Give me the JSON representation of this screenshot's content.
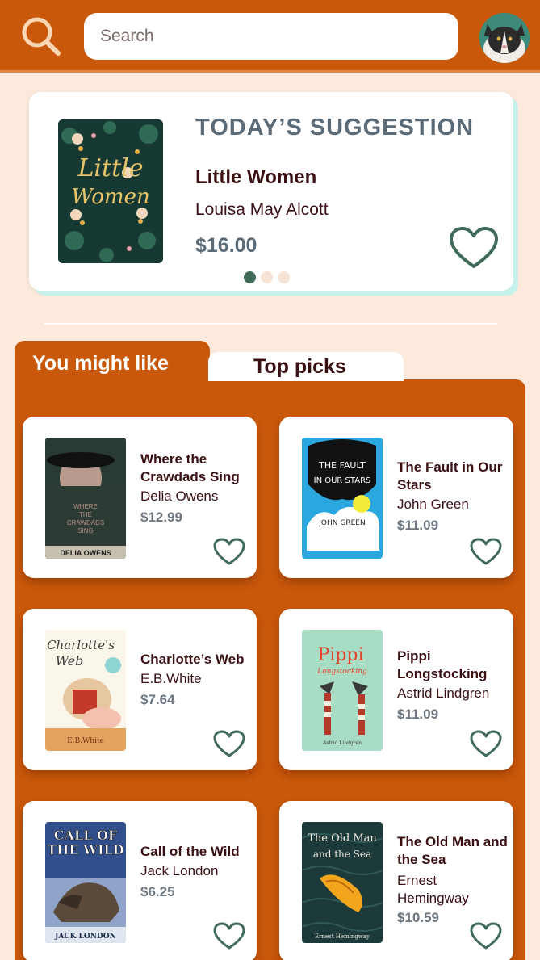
{
  "search": {
    "placeholder": "Search"
  },
  "suggestion": {
    "heading": "TODAY’S SUGGESTION",
    "title": "Little Women",
    "author": "Louisa May Alcott",
    "price": "$16.00",
    "cover_text": [
      "Little",
      "Women"
    ]
  },
  "tabs": {
    "active": "You might like",
    "inactive": "Top picks"
  },
  "books": [
    {
      "title": "Where the Crawdads Sing",
      "author": "Delia Owens",
      "price": "$12.99",
      "cover_lines": [
        "WHERE",
        "THE",
        "CRAWDADS",
        "SING"
      ],
      "cover_author": "DELIA OWENS"
    },
    {
      "title": "The Fault in Our Stars",
      "author": "John Green",
      "price": "$11.09",
      "cover_lines": [
        "THE FAULT",
        "IN OUR STARS"
      ],
      "cover_author": "JOHN GREEN"
    },
    {
      "title": "Charlotte’s Web",
      "author": "E.B.White",
      "price": "$7.64",
      "cover_lines": [
        "Charlotte's",
        "Web"
      ],
      "cover_author": "E.B.White"
    },
    {
      "title": "Pippi Longstocking",
      "author": "Astrid Lindgren",
      "price": "$11.09",
      "cover_lines": [
        "Pippi",
        "Longstocking"
      ],
      "cover_author": "Astrid Lindgren"
    },
    {
      "title": "Call of the Wild",
      "author": "Jack London",
      "price": "$6.25",
      "cover_lines": [
        "CALL OF",
        "THE WILD"
      ],
      "cover_author": "JACK LONDON"
    },
    {
      "title": "The Old Man and the Sea",
      "author": "Ernest Hemingway",
      "price": "$10.59",
      "cover_lines": [
        "The Old Man",
        "and the Sea"
      ],
      "cover_author": "Ernest Hemingway"
    }
  ],
  "colors": {
    "brand_orange": "#c9580a",
    "background_peach": "#fdeadc",
    "heart_green": "#3f6b58",
    "accent_mint": "#c6f1ea"
  },
  "icons": {
    "search": "search-icon",
    "heart": "heart-icon",
    "avatar": "cat-avatar"
  }
}
